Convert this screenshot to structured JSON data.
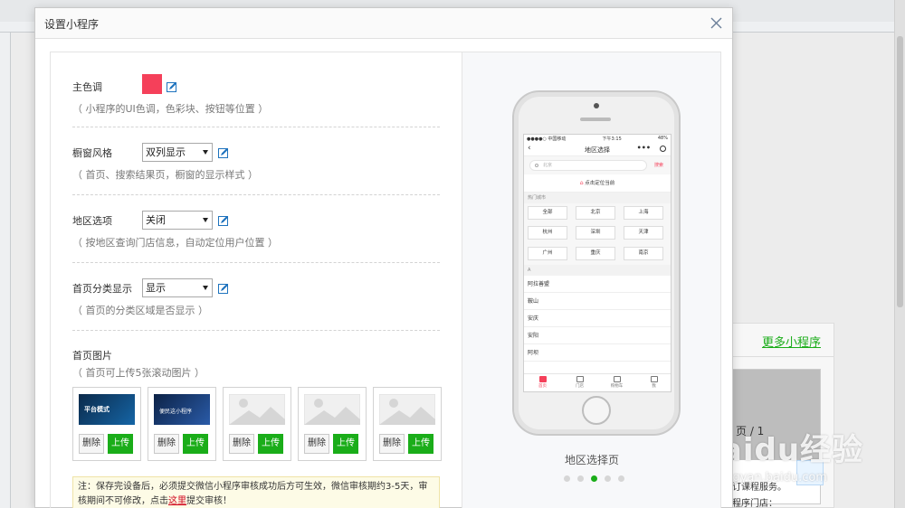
{
  "modal": {
    "title": "设置小程序"
  },
  "settings": {
    "theme_color": {
      "label": "主色调",
      "hint": "（ 小程序的UI色调，色彩块、按钮等位置 ）",
      "value": "#f5405a"
    },
    "window_style": {
      "label": "橱窗风格",
      "selected": "双列显示",
      "hint": "（ 首页、搜索结果页，橱窗的显示样式 ）"
    },
    "region_option": {
      "label": "地区选项",
      "selected": "关闭",
      "hint": "（ 按地区查询门店信息，自动定位用户位置 ）"
    },
    "home_category": {
      "label": "首页分类显示",
      "selected": "显示",
      "hint": "（ 首页的分类区域是否显示 ）"
    },
    "home_images": {
      "label": "首页图片",
      "hint": "（ 首页可上传5张滚动图片 ）",
      "items": [
        {
          "caption": "平台模式",
          "delete_label": "删除",
          "upload_label": "上传"
        },
        {
          "caption": "便民这小程序",
          "delete_label": "删除",
          "upload_label": "上传"
        },
        {
          "caption": "",
          "delete_label": "删除",
          "upload_label": "上传"
        },
        {
          "caption": "",
          "delete_label": "删除",
          "upload_label": "上传"
        },
        {
          "caption": "",
          "delete_label": "删除",
          "upload_label": "上传"
        }
      ]
    },
    "notice": {
      "text_before": "注：保存完设备后，必须提交微信小程序审核成功后方可生效，微信审核期约3-5天，审核期间不可修改，点击",
      "link": "这里",
      "text_after": "提交审核！"
    }
  },
  "preview": {
    "caption": "地区选择页",
    "screen": {
      "status_left": "●●●●○ 中国移动",
      "status_time": "下午3:15",
      "status_right": "48%",
      "nav_title": "地区选择",
      "search_placeholder": "北京",
      "search_button": "搜索",
      "locate_text": "点击定位当前",
      "hot_label": "热门城市",
      "hot_cities": [
        "全部",
        "北京",
        "上海",
        "杭州",
        "深圳",
        "天津",
        "广州",
        "重庆",
        "南京"
      ],
      "letter": "A",
      "cities": [
        "阿拉善盟",
        "鞍山",
        "安庆",
        "安阳",
        "阿坝"
      ],
      "tabs": [
        "首页",
        "门店",
        "购物车",
        "我"
      ]
    },
    "dots": 5,
    "active_dot": 2
  },
  "background": {
    "more_link": "更多小程序",
    "page_indicator": "页 / 1",
    "text1": "预订课程服务。",
    "text2": "小程序门店：",
    "watermark": "Baidu经验",
    "watermark_url": "jingyan.baidu.com"
  },
  "colors": {
    "accent": "#1aad19",
    "theme": "#f5405a"
  }
}
